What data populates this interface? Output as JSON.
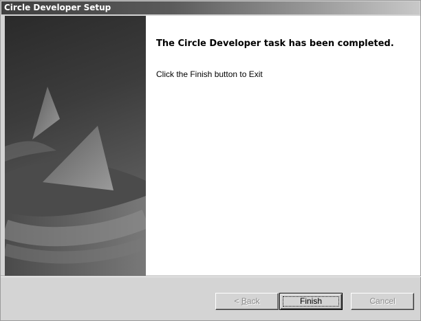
{
  "window": {
    "title": "Circle Developer Setup"
  },
  "main": {
    "heading": "The Circle Developer task has been completed.",
    "message": "Click the Finish button to Exit"
  },
  "buttons": {
    "back": {
      "prefix": "< ",
      "accel": "B",
      "rest": "ack",
      "enabled": false
    },
    "finish": {
      "label": "Finish",
      "enabled": true,
      "default": true
    },
    "cancel": {
      "label": "Cancel",
      "enabled": false
    }
  },
  "colors": {
    "title_text": "#ffffff",
    "dialog_face": "#d4d4d4",
    "content_bg": "#ffffff",
    "disabled_text": "#8a8a8a"
  },
  "icons": {
    "side_banner": "abstract-swirl-graphic"
  }
}
